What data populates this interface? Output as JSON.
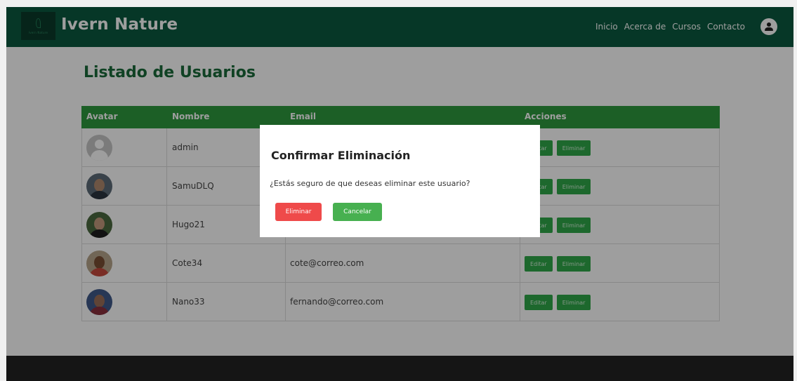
{
  "navbar": {
    "brand": "Ivern Nature",
    "logo_text": "Ivern Nature",
    "links": [
      "Inicio",
      "Acerca de",
      "Cursos",
      "Contacto"
    ],
    "user_icon": "user-circle-icon"
  },
  "page_title": "Listado de Usuarios",
  "table": {
    "headers": [
      "Avatar",
      "Nombre",
      "Email",
      "Acciones"
    ],
    "rows": [
      {
        "name": "admin",
        "email": "",
        "avatar": "generic-avatar"
      },
      {
        "name": "SamuDLQ",
        "email": "",
        "avatar": "photo"
      },
      {
        "name": "Hugo21",
        "email": "",
        "avatar": "photo"
      },
      {
        "name": "Cote34",
        "email": "cote@correo.com",
        "avatar": "photo"
      },
      {
        "name": "Nano33",
        "email": "fernando@correo.com",
        "avatar": "photo"
      }
    ],
    "edit_label": "Editar",
    "delete_label": "Eliminar"
  },
  "modal": {
    "title": "Confirmar Eliminación",
    "text": "¿Estás seguro de que deseas eliminar este usuario?",
    "confirm_label": "Eliminar",
    "cancel_label": "Cancelar"
  },
  "colors": {
    "navbar": "#0b5a3f",
    "table_header": "#2e9a3e",
    "action_button": "#2fa84a",
    "danger": "#ef4a4a",
    "cancel": "#47b050",
    "footer": "#222222"
  }
}
